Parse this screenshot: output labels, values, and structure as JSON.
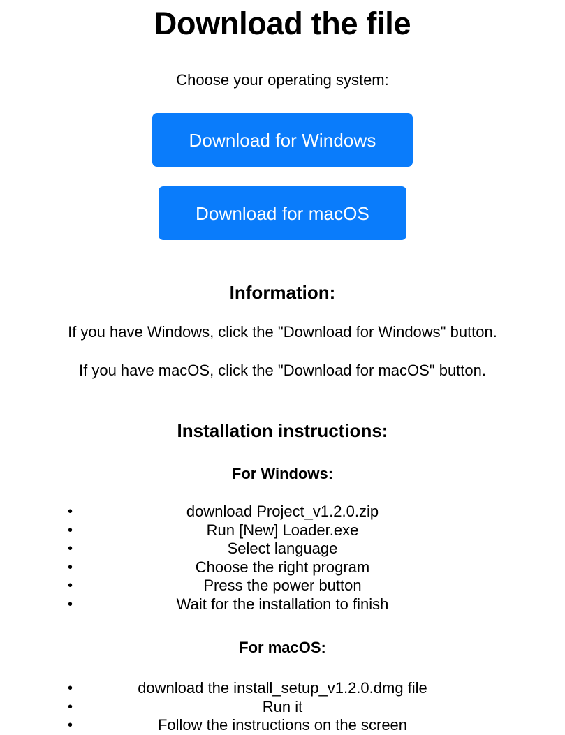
{
  "page": {
    "title": "Download the file",
    "subtitle": "Choose your operating system:",
    "background_color": "#ffffff",
    "text_color": "#000000"
  },
  "buttons": {
    "accent_color": "#0a7cfb",
    "label_color": "#ffffff",
    "windows": {
      "label": "Download for Windows",
      "name": "download-windows-button"
    },
    "macos": {
      "label": "Download for macOS",
      "name": "download-macos-button"
    }
  },
  "information": {
    "heading": "Information:",
    "lines": [
      "If you have Windows, click the \"Download for Windows\" button.",
      "If you have macOS, click the \"Download for macOS\" button."
    ]
  },
  "instructions": {
    "heading": "Installation instructions:",
    "windows": {
      "heading": "For Windows:",
      "bullet_glyph": "•",
      "steps": [
        "download Project_v1.2.0.zip",
        "Run [New] Loader.exe",
        "Select language",
        "Choose the right program",
        "Press the power button",
        "Wait for the installation to finish"
      ]
    },
    "macos": {
      "heading": "For macOS:",
      "bullet_glyph": "•",
      "steps": [
        "download the install_setup_v1.2.0.dmg file",
        "Run it",
        "Follow the instructions on the screen"
      ]
    }
  }
}
